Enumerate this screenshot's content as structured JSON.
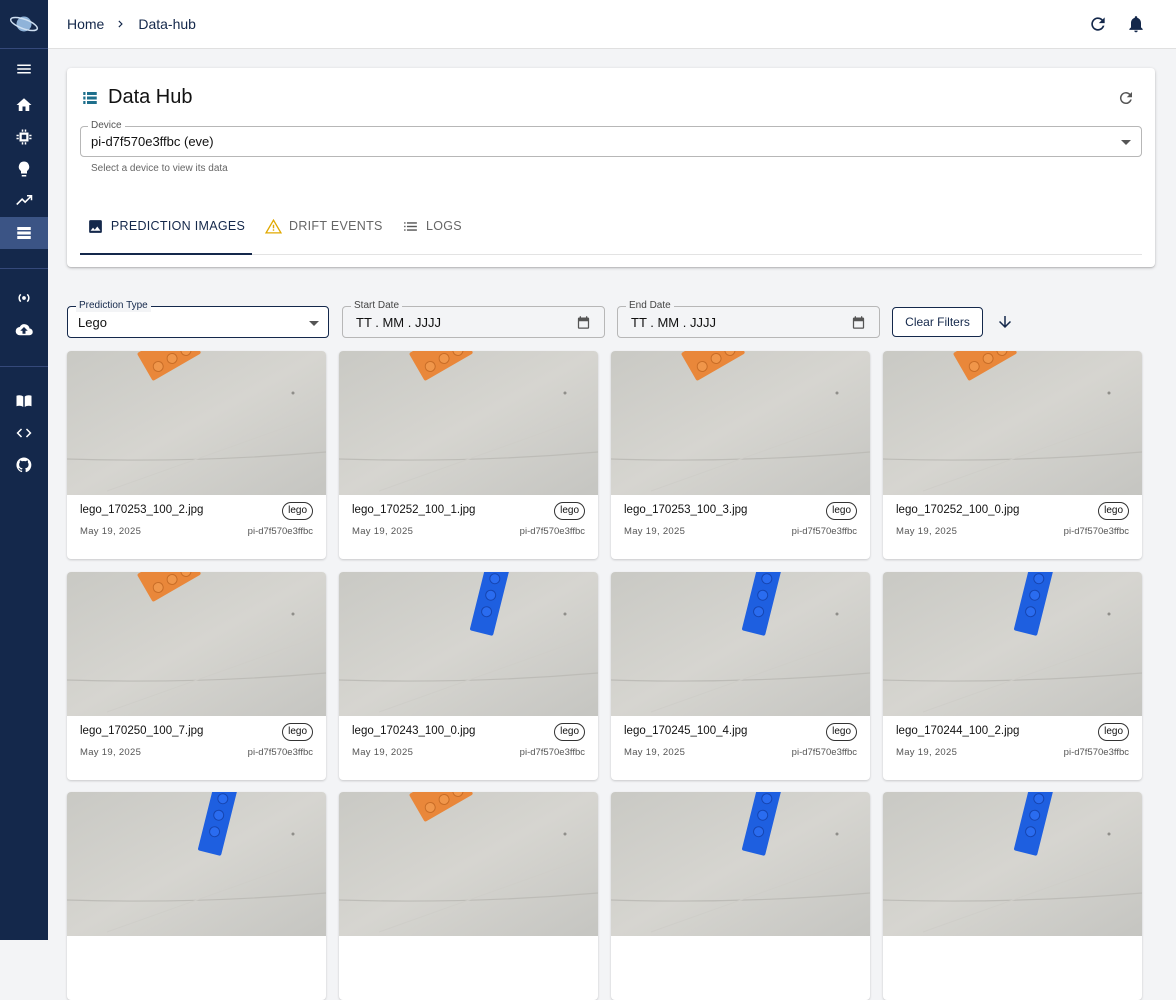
{
  "breadcrumb": {
    "home": "Home",
    "current": "Data-hub"
  },
  "panel": {
    "title": "Data Hub",
    "device_label": "Device",
    "device_value": "pi-d7f570e3ffbc (eve)",
    "device_helper": "Select a device to view its data",
    "tabs": [
      {
        "label": "PREDICTION IMAGES",
        "icon": "image-icon",
        "active": true
      },
      {
        "label": "DRIFT EVENTS",
        "icon": "warning-icon",
        "active": false
      },
      {
        "label": "LOGS",
        "icon": "list-icon",
        "active": false
      }
    ]
  },
  "filters": {
    "prediction_type_label": "Prediction Type",
    "prediction_type_value": "Lego",
    "start_date_label": "Start Date",
    "start_date_placeholder": "TT . MM . JJJJ",
    "end_date_label": "End Date",
    "end_date_placeholder": "TT . MM . JJJJ",
    "clear_label": "Clear Filters"
  },
  "images": [
    {
      "file": "lego_170253_100_2.jpg",
      "tag": "lego",
      "date": "May 19, 2025",
      "device": "pi-d7f570e3ffbc",
      "brick": "orange"
    },
    {
      "file": "lego_170252_100_1.jpg",
      "tag": "lego",
      "date": "May 19, 2025",
      "device": "pi-d7f570e3ffbc",
      "brick": "orange"
    },
    {
      "file": "lego_170253_100_3.jpg",
      "tag": "lego",
      "date": "May 19, 2025",
      "device": "pi-d7f570e3ffbc",
      "brick": "orange"
    },
    {
      "file": "lego_170252_100_0.jpg",
      "tag": "lego",
      "date": "May 19, 2025",
      "device": "pi-d7f570e3ffbc",
      "brick": "orange"
    },
    {
      "file": "lego_170250_100_7.jpg",
      "tag": "lego",
      "date": "May 19, 2025",
      "device": "pi-d7f570e3ffbc",
      "brick": "orange"
    },
    {
      "file": "lego_170243_100_0.jpg",
      "tag": "lego",
      "date": "May 19, 2025",
      "device": "pi-d7f570e3ffbc",
      "brick": "blue"
    },
    {
      "file": "lego_170245_100_4.jpg",
      "tag": "lego",
      "date": "May 19, 2025",
      "device": "pi-d7f570e3ffbc",
      "brick": "blue"
    },
    {
      "file": "lego_170244_100_2.jpg",
      "tag": "lego",
      "date": "May 19, 2025",
      "device": "pi-d7f570e3ffbc",
      "brick": "blue"
    },
    {
      "file": "",
      "tag": "",
      "date": "",
      "device": "",
      "brick": "blue"
    },
    {
      "file": "",
      "tag": "",
      "date": "",
      "device": "",
      "brick": "orange"
    },
    {
      "file": "",
      "tag": "",
      "date": "",
      "device": "",
      "brick": "blue"
    },
    {
      "file": "",
      "tag": "",
      "date": "",
      "device": "",
      "brick": "blue"
    }
  ],
  "colors": {
    "navy": "#14284b",
    "sidebar_active": "#3b5485",
    "accent_icon": "#1e6f8c",
    "warning": "#e0a800"
  }
}
